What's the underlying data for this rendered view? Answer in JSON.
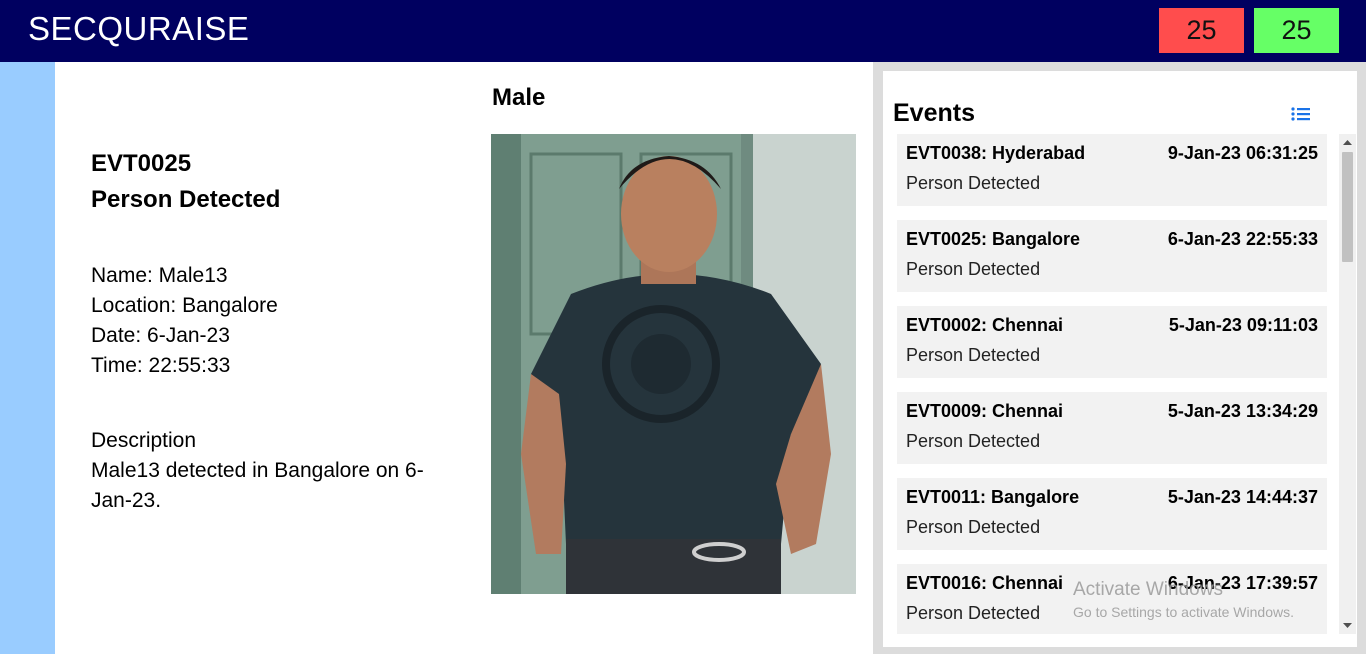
{
  "header": {
    "brand": "SECQURAISE",
    "count_red": "25",
    "count_green": "25",
    "background": "#000060",
    "red_color": "#ff4d4d",
    "green_color": "#66ff66"
  },
  "detail": {
    "event_id": "EVT0025",
    "event_type": "Person Detected",
    "name": "Name: Male13",
    "location": "Location: Bangalore",
    "date": "Date: 6-Jan-23",
    "time": "Time: 22:55:33",
    "description_label": "Description",
    "description_text": "Male13 detected in Bangalore on 6-Jan-23."
  },
  "photo": {
    "gender": "Male"
  },
  "events": {
    "title": "Events",
    "filter_icon": "list-icon",
    "items": [
      {
        "name": "EVT0038: Hyderabad",
        "datetime": "9-Jan-23 06:31:25",
        "type": "Person Detected"
      },
      {
        "name": "EVT0025: Bangalore",
        "datetime": "6-Jan-23 22:55:33",
        "type": "Person Detected"
      },
      {
        "name": "EVT0002: Chennai",
        "datetime": "5-Jan-23 09:11:03",
        "type": "Person Detected"
      },
      {
        "name": "EVT0009: Chennai",
        "datetime": "5-Jan-23 13:34:29",
        "type": "Person Detected"
      },
      {
        "name": "EVT0011: Bangalore",
        "datetime": "5-Jan-23 14:44:37",
        "type": "Person Detected"
      },
      {
        "name": "EVT0016: Chennai",
        "datetime": "6-Jan-23 17:39:57",
        "type": "Person Detected"
      }
    ]
  },
  "watermark": {
    "title": "Activate Windows",
    "subtitle": "Go to Settings to activate Windows."
  },
  "colors": {
    "left_strip": "#99ccff",
    "panel_bg": "#dcdcdc",
    "card_bg": "#f2f2f2",
    "accent_icon": "#1a73e8"
  }
}
